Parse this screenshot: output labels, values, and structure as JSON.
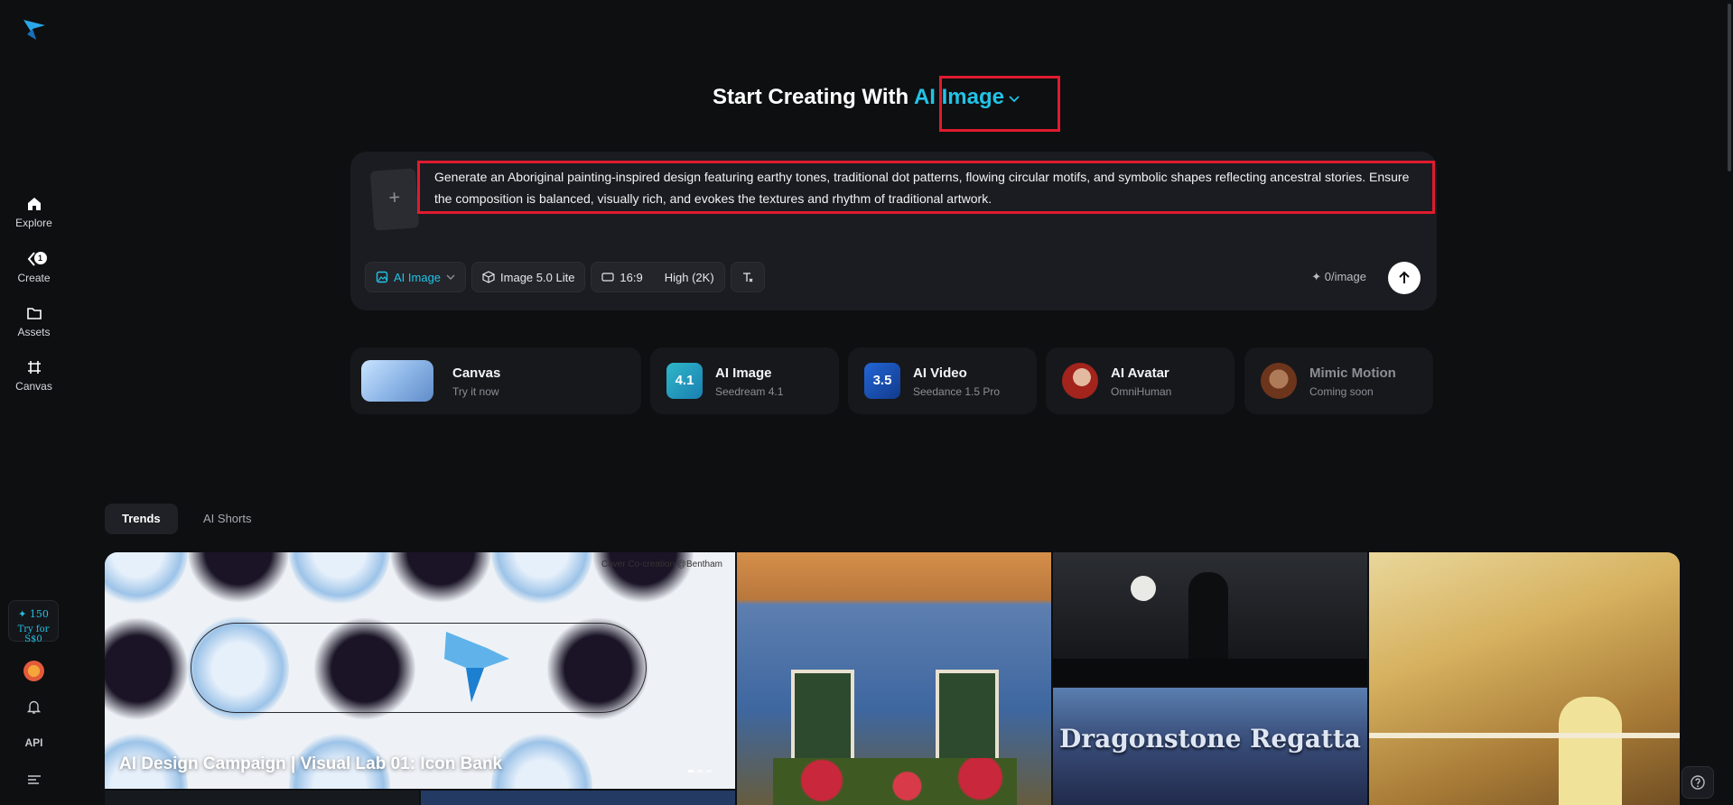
{
  "sidebar": {
    "logo": "paper-plane-logo",
    "items": [
      {
        "label": "Explore",
        "icon": "home-icon"
      },
      {
        "label": "Create",
        "icon": "create-icon",
        "badge": "1"
      },
      {
        "label": "Assets",
        "icon": "folder-icon"
      },
      {
        "label": "Canvas",
        "icon": "frame-icon"
      }
    ],
    "credits": {
      "amount": "✦ 150",
      "offer": "Try for S$0"
    },
    "api_label": "API"
  },
  "hero": {
    "title_prefix": "Start Creating With",
    "mode": "AI Image"
  },
  "prompt": {
    "text": "Generate an Aboriginal painting-inspired design featuring earthy tones, traditional dot patterns, flowing circular motifs, and symbolic shapes reflecting ancestral stories. Ensure the composition is balanced, visually rich, and evokes the textures and rhythm of traditional artwork.",
    "add_reference": "+"
  },
  "toolbar": {
    "mode_label": "AI Image",
    "model_label": "Image 5.0 Lite",
    "ratio_label": "16:9",
    "quality_label": "High (2K)",
    "cost_label": "0/image"
  },
  "features": [
    {
      "name": "Canvas",
      "sub": "Try it now"
    },
    {
      "name": "AI Image",
      "sub": "Seedream 4.1",
      "badge": "4.1"
    },
    {
      "name": "AI Video",
      "sub": "Seedance 1.5 Pro",
      "badge": "3.5"
    },
    {
      "name": "AI Avatar",
      "sub": "OmniHuman"
    },
    {
      "name": "Mimic Motion",
      "sub": "Coming soon"
    }
  ],
  "tabs": [
    {
      "label": "Trends",
      "active": true
    },
    {
      "label": "AI Shorts",
      "active": false
    }
  ],
  "gallery": {
    "featured_caption": "AI Design Campaign | Visual Lab 01: Icon Bank",
    "featured_credit": "Cover Co-creation @Bentham",
    "dragon_title": "Dragonstone Regatta"
  },
  "colors": {
    "accent": "#22c3e6",
    "highlight": "#e01b2e",
    "background": "#0e0f11",
    "card": "#1b1c21"
  }
}
